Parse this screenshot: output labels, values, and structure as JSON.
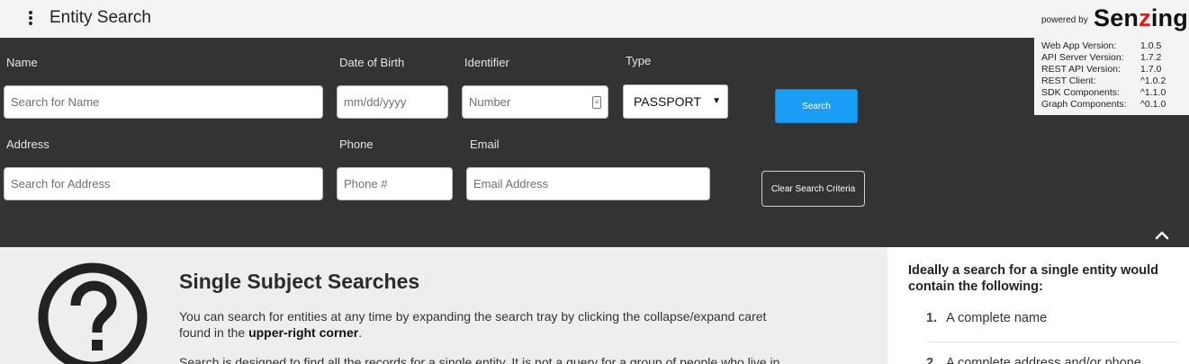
{
  "header": {
    "title": "Entity Search",
    "powered_by": "powered by",
    "logo_pre": "Sen",
    "logo_accent": "z",
    "logo_post": "ing"
  },
  "versions": [
    {
      "label": "Web App Version:",
      "value": "1.0.5"
    },
    {
      "label": "API Server Version:",
      "value": "1.7.2"
    },
    {
      "label": "REST API Version:",
      "value": "1.7.0"
    },
    {
      "label": "REST Client:",
      "value": "^1.0.2"
    },
    {
      "label": "SDK Components:",
      "value": "^1.1.0"
    },
    {
      "label": "Graph Components:",
      "value": "^0.1.0"
    }
  ],
  "search": {
    "name_label": "Name",
    "name_placeholder": "Search for Name",
    "dob_label": "Date of Birth",
    "dob_placeholder": "mm/dd/yyyy",
    "identifier_label": "Identifier",
    "identifier_placeholder": "Number",
    "type_label": "Type",
    "type_value": "PASSPORT",
    "search_button": "Search",
    "address_label": "Address",
    "address_placeholder": "Search for Address",
    "phone_label": "Phone",
    "phone_placeholder": "Phone #",
    "email_label": "Email",
    "email_placeholder": "Email Address",
    "clear_button": "Clear Search Criteria"
  },
  "content": {
    "title": "Single Subject Searches",
    "p1_a": "You can search for entities at any time by expanding the search tray by clicking the collapse/expand caret",
    "p1_b": "found in the ",
    "p1_bold": "upper-right corner",
    "p1_c": ".",
    "p2": "Search is designed to find all the records for a single entity. It is not a query for a group of people who live in"
  },
  "side": {
    "title": "Ideally a search for a single entity would contain the following:",
    "items": [
      {
        "num": "1.",
        "text": "A complete name"
      },
      {
        "num": "2.",
        "text": "A complete address and/or phone"
      }
    ]
  },
  "colors": {
    "tray": "#333333",
    "search_button": "#1a9ef5",
    "logo_accent": "#e21b1b"
  }
}
